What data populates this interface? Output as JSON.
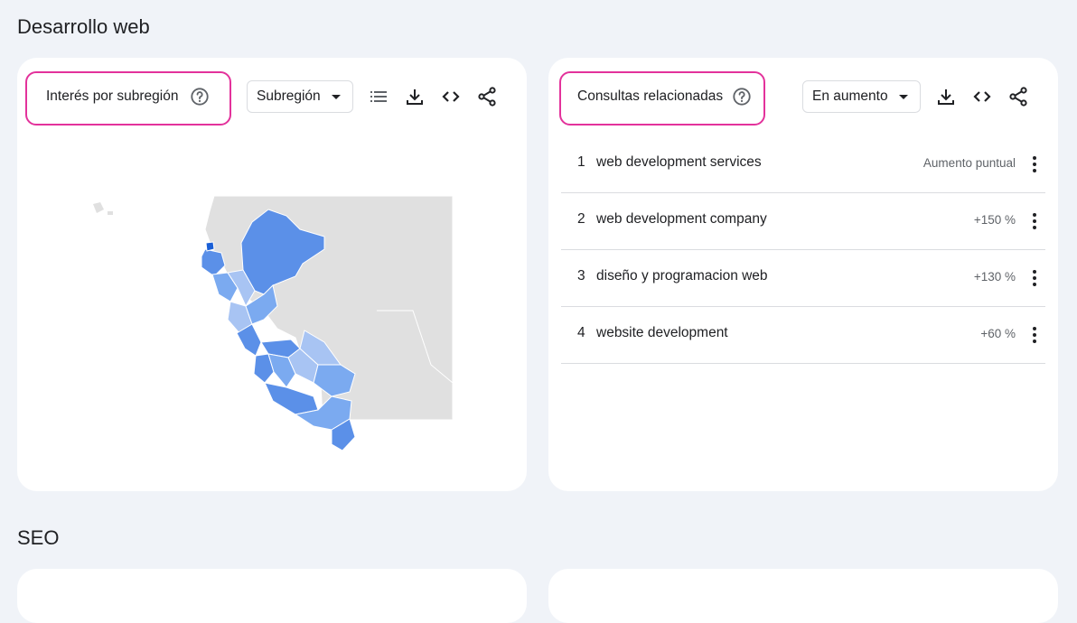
{
  "sections": [
    {
      "title": "Desarrollo web"
    },
    {
      "title": "SEO"
    }
  ],
  "region_card": {
    "title": "Interés por subregión",
    "help_icon": "help-circle-icon",
    "dropdown_value": "Subregión",
    "tools": [
      "list-icon",
      "download-icon",
      "embed-code-icon",
      "share-icon"
    ],
    "map_colors": {
      "light": "#a8c4f3",
      "mid": "#7baaf0",
      "strong": "#5b90e8",
      "darkest": "#1a5fd6",
      "land": "#e0e0e0"
    }
  },
  "queries_card": {
    "title": "Consultas relacionadas",
    "help_icon": "help-circle-icon",
    "dropdown_value": "En aumento",
    "tools": [
      "download-icon",
      "embed-code-icon",
      "share-icon"
    ],
    "rows": [
      {
        "rank": "1",
        "query": "web development services",
        "value": "Aumento puntual"
      },
      {
        "rank": "2",
        "query": "web development company",
        "value": "+150 %"
      },
      {
        "rank": "3",
        "query": "diseño y programacion web",
        "value": "+130 %"
      },
      {
        "rank": "4",
        "query": "website development",
        "value": "+60 %"
      }
    ]
  },
  "colors": {
    "highlight": "#e3329b",
    "background": "#f0f3f8",
    "card": "#ffffff"
  }
}
